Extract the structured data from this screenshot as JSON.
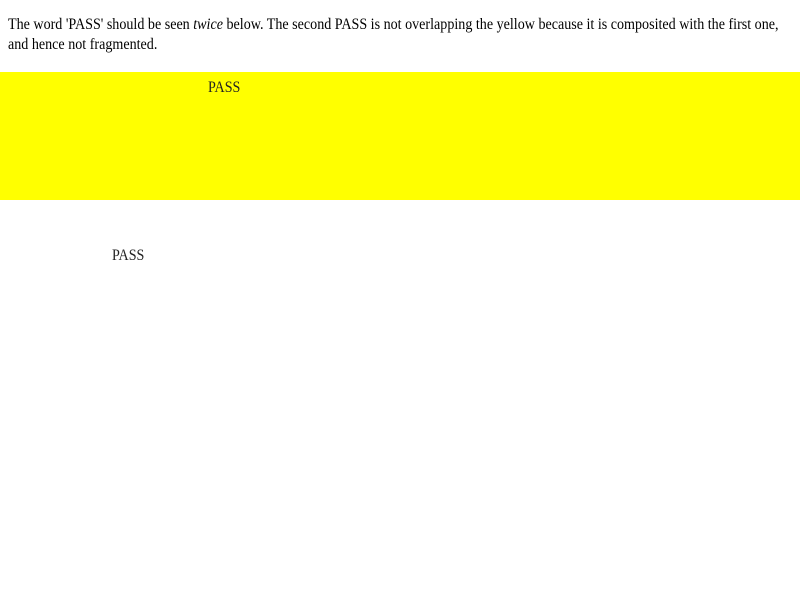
{
  "description": {
    "before_emphasis": "The word 'PASS' should be seen ",
    "emphasis": "twice",
    "after_emphasis": " below. The second PASS is not overlapping the yellow because it is composited with the first one, and hence not fragmented."
  },
  "first_pass": "PASS",
  "second_pass": "PASS",
  "colors": {
    "band": "#ffff00"
  }
}
